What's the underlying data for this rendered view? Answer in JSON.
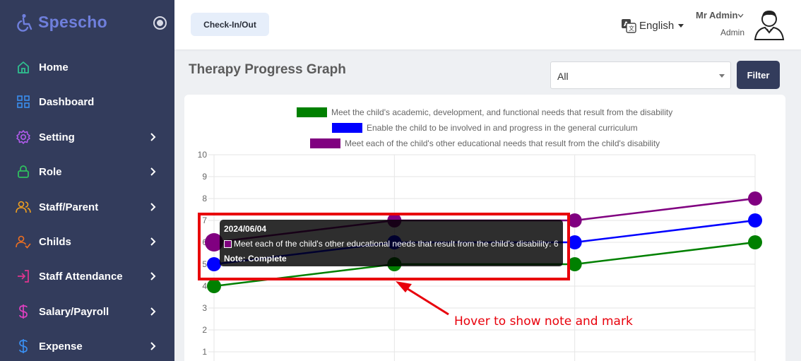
{
  "app": {
    "logo_text": "Spescho"
  },
  "sidebar": {
    "items": [
      {
        "label": "Home",
        "icon": "home-icon",
        "color": "#2fbf8f",
        "has_chevron": false
      },
      {
        "label": "Dashboard",
        "icon": "grid-icon",
        "color": "#3a8ef0",
        "has_chevron": false
      },
      {
        "label": "Setting",
        "icon": "gear-icon",
        "color": "#b45cf0",
        "has_chevron": true
      },
      {
        "label": "Role",
        "icon": "lock-icon",
        "color": "#2fbf5f",
        "has_chevron": true
      },
      {
        "label": "Staff/Parent",
        "icon": "users-icon",
        "color": "#f0a020",
        "has_chevron": true
      },
      {
        "label": "Childs",
        "icon": "user-check-icon",
        "color": "#f07020",
        "has_chevron": true
      },
      {
        "label": "Staff Attendance",
        "icon": "login-icon",
        "color": "#e0358f",
        "has_chevron": true
      },
      {
        "label": "Salary/Payroll",
        "icon": "dollar-icon",
        "color": "#e040c0",
        "has_chevron": true
      },
      {
        "label": "Expense",
        "icon": "dollar-icon",
        "color": "#3a8ef0",
        "has_chevron": true
      }
    ]
  },
  "header": {
    "checkin_label": "Check-In/Out",
    "language": "English",
    "user_name": "Mr Admin",
    "user_role": "Admin"
  },
  "main": {
    "title": "Therapy Progress Graph",
    "filter_select_value": "All",
    "filter_button_label": "Filter"
  },
  "tooltip": {
    "title": "2024/06/04",
    "line": "Meet each of the child's other educational needs that result from the child's disability: 6",
    "note": "Note: Complete"
  },
  "annotation": {
    "text": "Hover to show note and mark",
    "highlight_color": "#e8000b"
  },
  "chart_data": {
    "type": "line",
    "title": "",
    "xlabel": "",
    "ylabel": "",
    "ylim": [
      0,
      10
    ],
    "yticks": [
      1,
      2,
      3,
      4,
      5,
      6,
      7,
      8,
      9,
      10
    ],
    "x": [
      "2024/06/04",
      "",
      "",
      ""
    ],
    "grid": true,
    "legend_position": "top",
    "series": [
      {
        "name": "Meet the child's academic, development, and functional needs that result from the disability",
        "color": "#008000",
        "values": [
          4,
          5,
          5,
          6
        ]
      },
      {
        "name": "Enable the child to be involved in and progress in the general curriculum",
        "color": "#0000ff",
        "values": [
          5,
          6,
          6,
          7
        ]
      },
      {
        "name": "Meet each of the child's other educational needs that result from the child's disability",
        "color": "#800080",
        "values": [
          6,
          7,
          7,
          8
        ]
      }
    ]
  }
}
